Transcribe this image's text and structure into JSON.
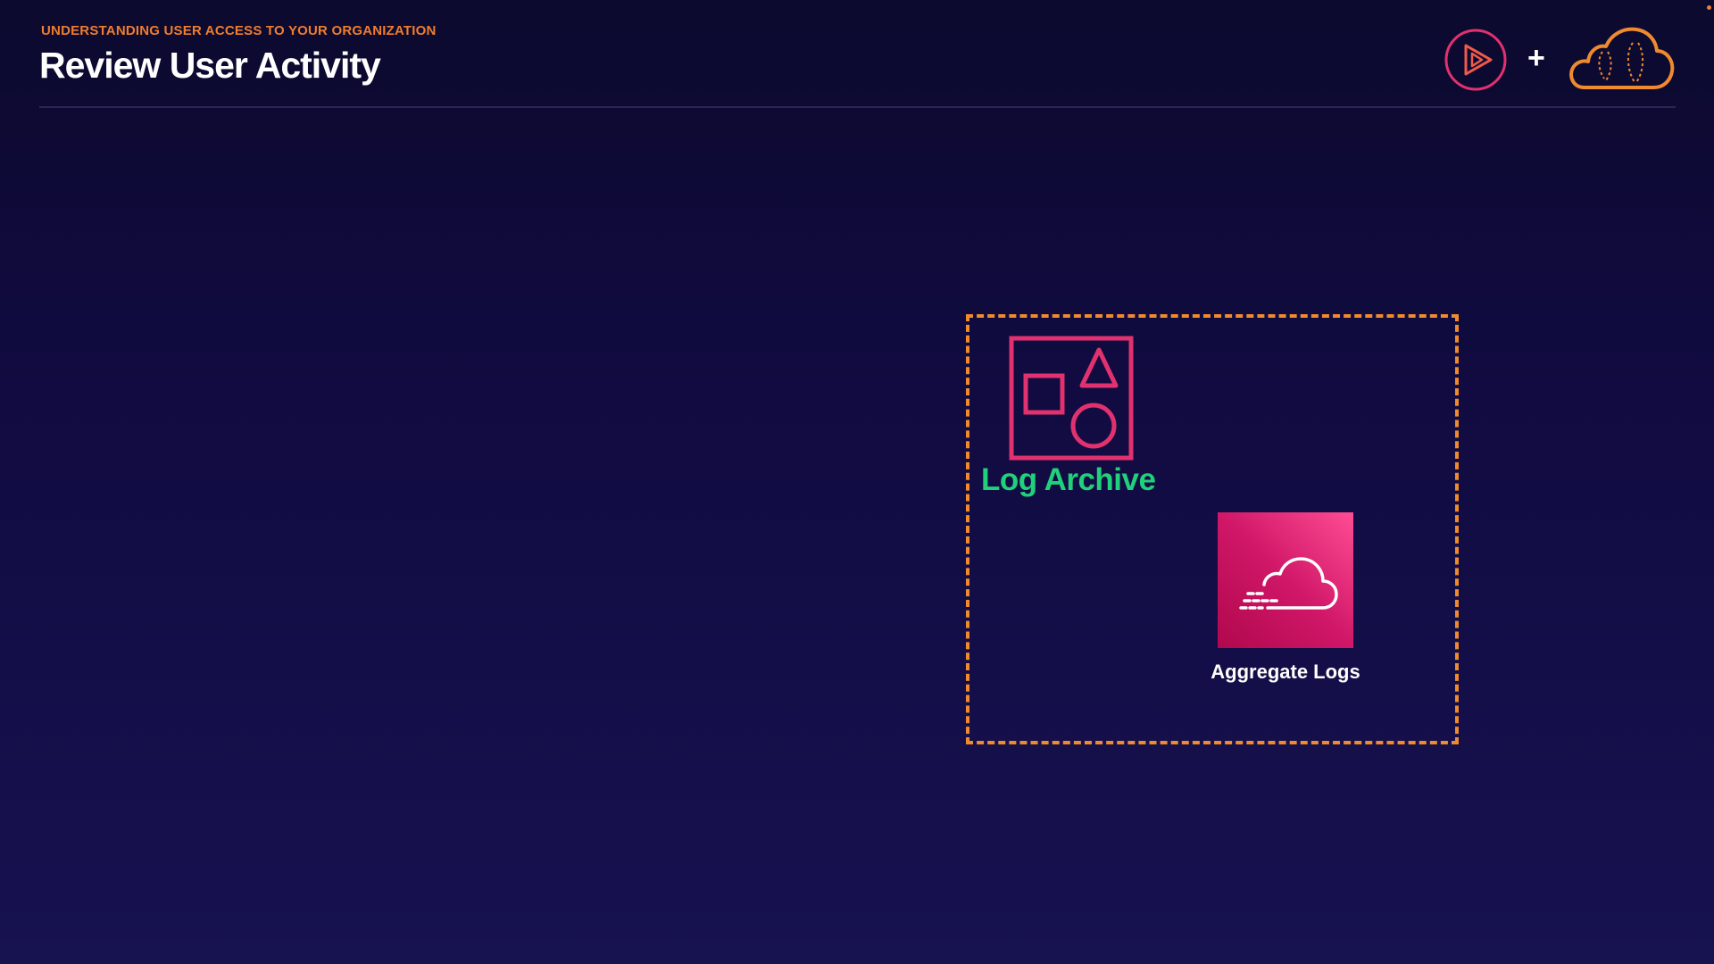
{
  "header": {
    "eyebrow": "UNDERSTANDING USER ACCESS TO YOUR ORGANIZATION",
    "title": "Review User Activity",
    "plus": "+"
  },
  "logos": [
    {
      "icon": "play-logo-icon"
    },
    {
      "icon": "cloud-logo-icon"
    }
  ],
  "diagram": {
    "account": {
      "label": "Log Archive",
      "icon": "organization-icon",
      "label_color": "#21d07a",
      "border_color": "#ef8a2e"
    },
    "service": {
      "label": "Aggregate Logs",
      "icon": "cloud-logs-icon"
    }
  },
  "colors": {
    "background_top": "#0c0a2e",
    "background_bottom": "#171250",
    "accent_orange": "#ef7d2e",
    "accent_pink": "#e1316f",
    "accent_green": "#21d07a"
  }
}
